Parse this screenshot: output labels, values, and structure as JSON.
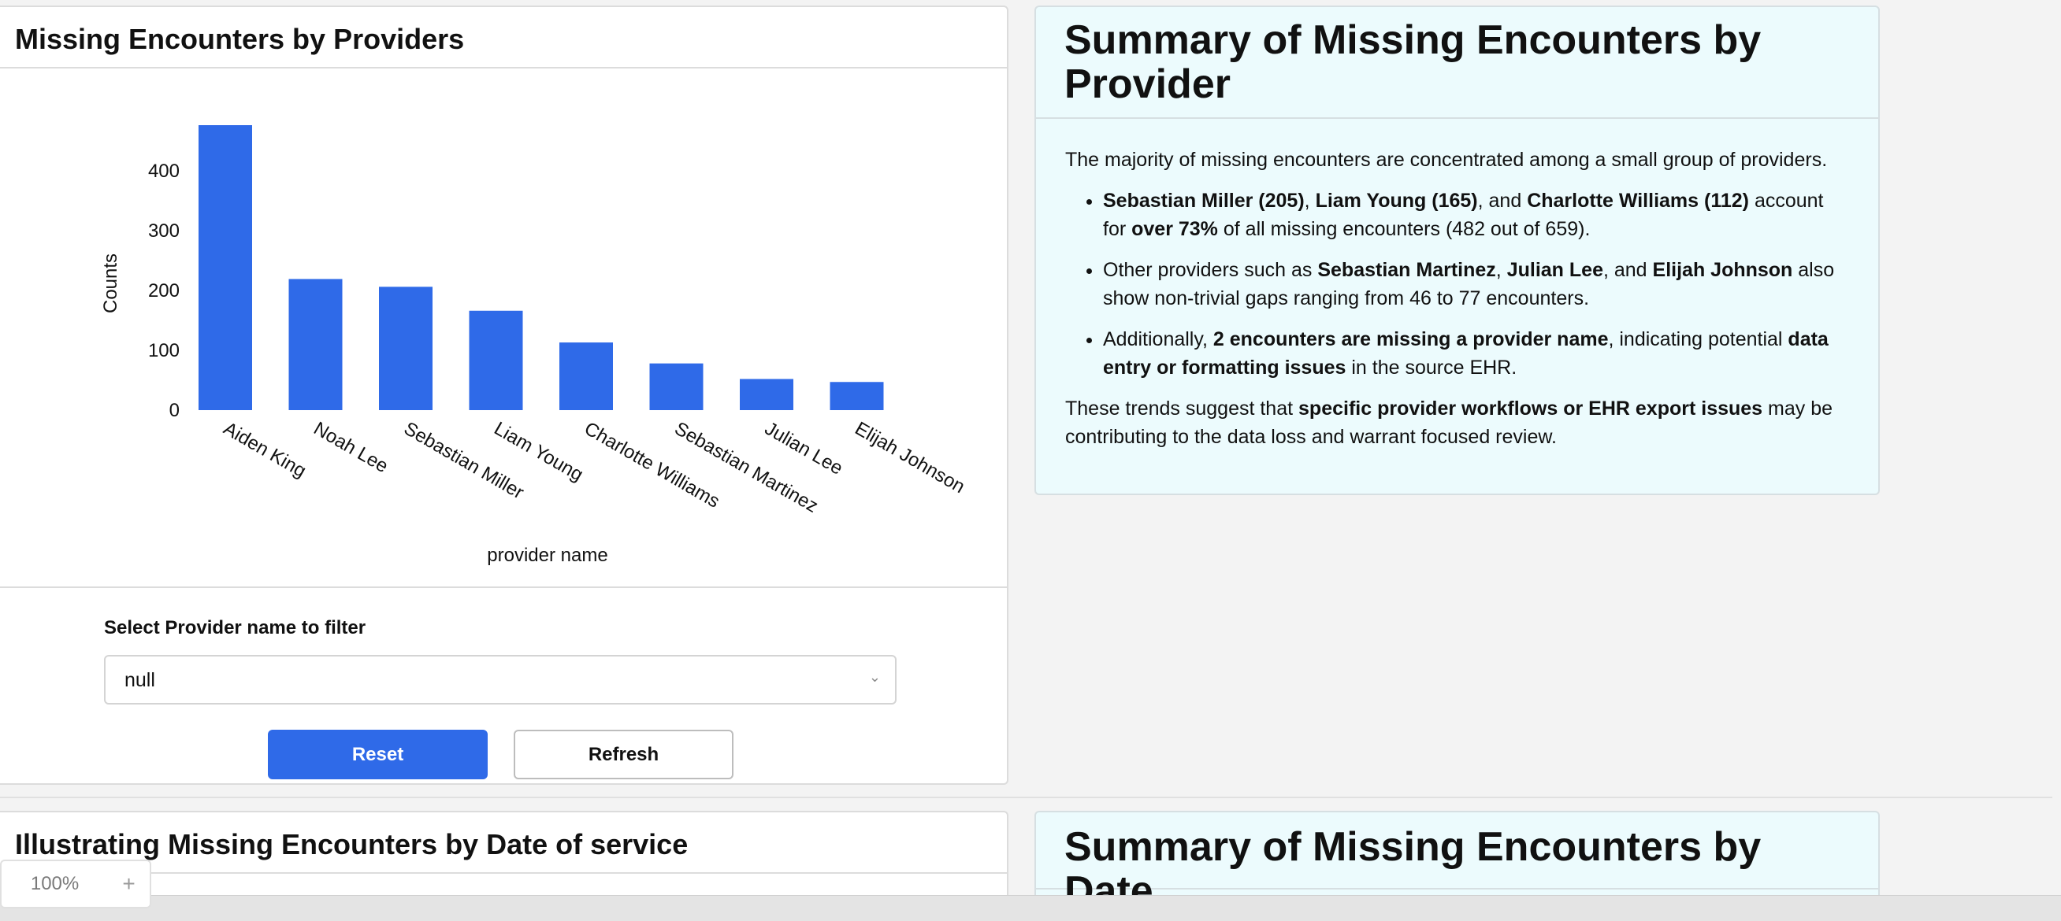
{
  "provider_card": {
    "title": "Missing Encounters by Providers",
    "filter_label": "Select Provider name to filter",
    "select_value": "null",
    "reset_label": "Reset",
    "refresh_label": "Refresh"
  },
  "chart_data": {
    "type": "bar",
    "categories": [
      "Aiden King",
      "Noah Lee",
      "Sebastian Miller",
      "Liam Young",
      "Charlotte Williams",
      "Sebastian Martinez",
      "Julian Lee",
      "Elijah Johnson"
    ],
    "values": [
      476,
      219,
      206,
      166,
      113,
      78,
      52,
      47
    ],
    "xlabel": "provider name",
    "ylabel": "Counts",
    "yticks": [
      0,
      100,
      200,
      300,
      400
    ],
    "ylim": [
      0,
      476
    ],
    "grid": false,
    "color": "#2f6ae8"
  },
  "provider_summary": {
    "title": "Summary of Missing Encounters by Provider",
    "intro": "The majority of missing encounters are concentrated among a small group of providers.",
    "b1": {
      "n1": "Sebastian Miller (205)",
      "s1": ", ",
      "n2": "Liam Young (165)",
      "s2": ", and ",
      "n3": "Charlotte Williams (112)",
      "s3": " account for ",
      "pct": "over 73%",
      "s4": " of all missing encounters (482 out of 659)."
    },
    "b2": {
      "s1": "Other providers such as ",
      "n1": "Sebastian Martinez",
      "s2": ", ",
      "n2": "Julian Lee",
      "s3": ", and ",
      "n3": "Elijah Johnson",
      "s4": " also show non-trivial gaps ranging from 46 to 77 encounters."
    },
    "b3": {
      "s1": "Additionally, ",
      "bold1": "2 encounters are missing a provider name",
      "s2": ", indicating potential ",
      "bold2": "data entry or formatting issues",
      "s3": " in the source EHR."
    },
    "outro": {
      "s1": "These trends suggest that ",
      "bold": "specific provider workflows or EHR export issues",
      "s2": " may be contributing to the data loss and warrant focused review."
    }
  },
  "date_card": {
    "title": "Illustrating Missing Encounters by Date of service"
  },
  "date_summary": {
    "title": "Summary of Missing Encounters by Date"
  },
  "zoom": {
    "value": "100%",
    "plus": "+"
  },
  "icons": {
    "chevron": "chevron-down-icon"
  }
}
